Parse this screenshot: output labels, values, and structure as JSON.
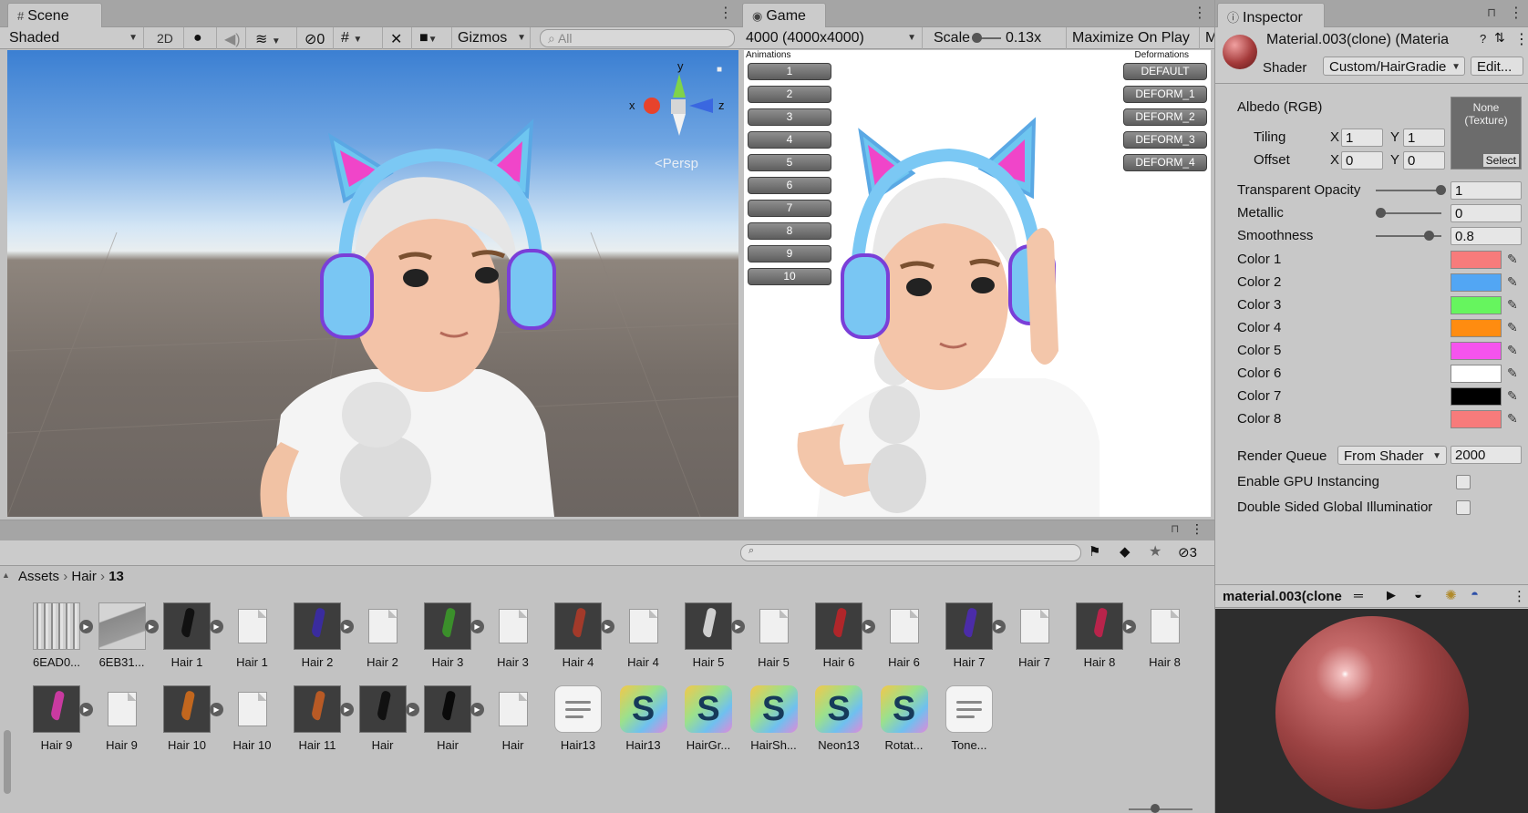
{
  "scene": {
    "tab_label": "Scene",
    "shading_mode": "Shaded",
    "mode_2d": "2D",
    "hidden_count": "0",
    "gizmos_label": "Gizmos",
    "search_placeholder": "All",
    "axis_x": "x",
    "axis_y": "y",
    "axis_z": "z",
    "persp_label": "Persp"
  },
  "game": {
    "tab_label": "Game",
    "resolution": "4000 (4000x4000)",
    "scale_label": "Scale",
    "scale_value": "0.13x",
    "maximize_label": "Maximize On Play",
    "mute_label": "M",
    "animations_title": "Animations",
    "deformations_title": "Deformations",
    "animation_buttons": [
      "1",
      "2",
      "3",
      "4",
      "5",
      "6",
      "7",
      "8",
      "9",
      "10"
    ],
    "deformation_buttons": [
      "DEFAULT",
      "DEFORM_1",
      "DEFORM_2",
      "DEFORM_3",
      "DEFORM_4"
    ]
  },
  "inspector": {
    "tab_label": "Inspector",
    "material_name": "Material.003(clone) (Materia",
    "shader_label": "Shader",
    "shader_value": "Custom/HairGradie",
    "edit_label": "Edit...",
    "albedo_label": "Albedo (RGB)",
    "texture_none": "None",
    "texture_kind": "(Texture)",
    "select_label": "Select",
    "tiling_label": "Tiling",
    "offset_label": "Offset",
    "x_label": "X",
    "y_label": "Y",
    "tiling_x": "1",
    "tiling_y": "1",
    "offset_x": "0",
    "offset_y": "0",
    "properties": [
      {
        "label": "Transparent Opacity",
        "value": "1",
        "fraction": 1.0
      },
      {
        "label": "Metallic",
        "value": "0",
        "fraction": 0.0
      },
      {
        "label": "Smoothness",
        "value": "0.8",
        "fraction": 0.8
      }
    ],
    "colors": [
      {
        "label": "Color 1",
        "hex": "#f77b7b"
      },
      {
        "label": "Color 2",
        "hex": "#52a6f4"
      },
      {
        "label": "Color 3",
        "hex": "#66f55e"
      },
      {
        "label": "Color 4",
        "hex": "#ff8c10"
      },
      {
        "label": "Color 5",
        "hex": "#f553ee"
      },
      {
        "label": "Color 6",
        "hex": "#ffffff"
      },
      {
        "label": "Color 7",
        "hex": "#000000"
      },
      {
        "label": "Color 8",
        "hex": "#f77b7b"
      }
    ],
    "render_queue_label": "Render Queue",
    "render_queue_mode": "From Shader",
    "render_queue_value": "2000",
    "gpu_instancing_label": "Enable GPU Instancing",
    "double_sided_label": "Double Sided Global Illuminatior",
    "preview_title": "material.003(clone"
  },
  "project": {
    "breadcrumb": [
      "Assets",
      "Hair",
      "13"
    ],
    "hidden_count": "3",
    "assets_row1": [
      {
        "label": "6EAD0...",
        "kind": "texture"
      },
      {
        "label": "6EB31...",
        "kind": "texture2"
      },
      {
        "label": "Hair 1",
        "kind": "model",
        "color": "#111111"
      },
      {
        "label": "Hair 1",
        "kind": "file"
      },
      {
        "label": "Hair 2",
        "kind": "model",
        "color": "#3a2c9e"
      },
      {
        "label": "Hair 2",
        "kind": "file"
      },
      {
        "label": "Hair 3",
        "kind": "model",
        "color": "#3b8f2b"
      },
      {
        "label": "Hair 3",
        "kind": "file"
      },
      {
        "label": "Hair 4",
        "kind": "model",
        "color": "#a33a2a"
      },
      {
        "label": "Hair 4",
        "kind": "file"
      },
      {
        "label": "Hair 5",
        "kind": "model",
        "color": "#cfcfcf"
      },
      {
        "label": "Hair 5",
        "kind": "file"
      },
      {
        "label": "Hair 6",
        "kind": "model",
        "color": "#b0262a"
      },
      {
        "label": "Hair 6",
        "kind": "file"
      },
      {
        "label": "Hair 7",
        "kind": "model",
        "color": "#4b2ca8"
      },
      {
        "label": "Hair 7",
        "kind": "file"
      },
      {
        "label": "Hair 8",
        "kind": "model",
        "color": "#b8244b"
      },
      {
        "label": "Hair 8",
        "kind": "file"
      }
    ],
    "assets_row2": [
      {
        "label": "Hair 9",
        "kind": "model",
        "color": "#c93aa0"
      },
      {
        "label": "Hair 9",
        "kind": "file"
      },
      {
        "label": "Hair 10",
        "kind": "model",
        "color": "#c2671e"
      },
      {
        "label": "Hair 10",
        "kind": "file"
      },
      {
        "label": "Hair 11",
        "kind": "model",
        "color": "#b85a25"
      },
      {
        "label": "Hair",
        "kind": "model",
        "color": "#111111"
      },
      {
        "label": "Hair",
        "kind": "model",
        "color": "#0a0a0a"
      },
      {
        "label": "Hair",
        "kind": "file"
      },
      {
        "label": "Hair13",
        "kind": "doc"
      },
      {
        "label": "Hair13",
        "kind": "shader"
      },
      {
        "label": "HairGr...",
        "kind": "shader"
      },
      {
        "label": "HairSh...",
        "kind": "shader"
      },
      {
        "label": "Neon13",
        "kind": "shader"
      },
      {
        "label": "Rotat...",
        "kind": "shader"
      },
      {
        "label": "Tone...",
        "kind": "doc"
      }
    ]
  }
}
